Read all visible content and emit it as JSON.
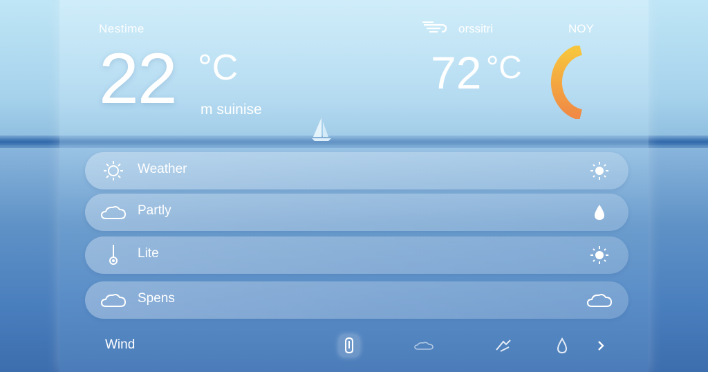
{
  "header": {
    "left_label": "Nestime",
    "main_temp": "22",
    "main_unit": "°C",
    "main_sub": "m suinise",
    "right_label": "orssitri",
    "right_far_label": "NOY",
    "secondary_temp": "72",
    "secondary_unit": "°C",
    "gauge_color": "#f0a046"
  },
  "rows": [
    {
      "label": "Weather",
      "left_icon": "sun-icon",
      "right_icon": "sun-icon"
    },
    {
      "label": "Partly",
      "left_icon": "cloud-icon",
      "right_icon": "raindrop-icon"
    },
    {
      "label": "Lite",
      "left_icon": "thermometer-icon",
      "right_icon": "sun-icon"
    },
    {
      "label": "Spens",
      "left_icon": "cloud-icon",
      "right_icon": "cloud-icon"
    }
  ],
  "footer": {
    "label": "Wind",
    "buttons": [
      "umbrella-icon",
      "cloud-icon",
      "wind-icon",
      "raindrop-icon",
      "chevron-right-icon"
    ]
  }
}
